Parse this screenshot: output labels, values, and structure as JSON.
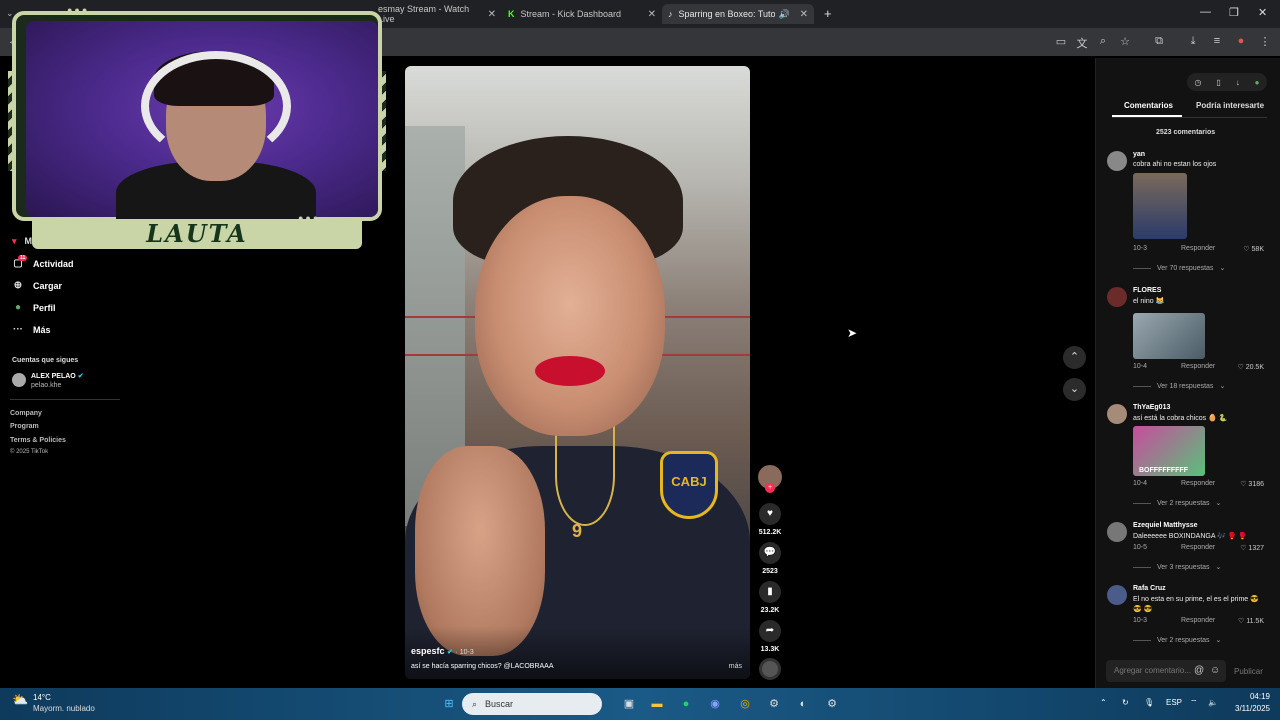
{
  "browser": {
    "tabs": [
      {
        "label": "esmay Stream - Watch Live",
        "active": false
      },
      {
        "label": "Stream - Kick Dashboard",
        "active": false
      },
      {
        "label": "Sparring en Boxeo: Tutorial",
        "active": true
      }
    ],
    "new_tab": "+"
  },
  "sidebar": {
    "items": [
      {
        "label": "Actividad",
        "icon": "activity-icon",
        "badge": "11"
      },
      {
        "label": "Cargar",
        "icon": "upload-icon"
      },
      {
        "label": "Perfil",
        "icon": "profile-icon"
      },
      {
        "label": "Más",
        "icon": "more-icon"
      }
    ],
    "partial_item": "M",
    "following_heading": "Cuentas que sigues",
    "following": [
      {
        "name": "ALEX PELAO",
        "handle": "pelao.khe"
      }
    ],
    "footer": [
      "Company",
      "Program",
      "Terms & Policies",
      "© 2025 TikTok"
    ]
  },
  "video": {
    "username": "espesfc",
    "date": "10-3",
    "caption": "así se hacía sparring chicos? @LACOBRAAA",
    "more": "más",
    "shirt_badge": "CABJ",
    "shirt_number": "9"
  },
  "actions": {
    "likes": "512.2K",
    "comments": "2523",
    "saves": "23.2K",
    "shares": "13.3K"
  },
  "comments_panel": {
    "tabs": [
      "Comentarios",
      "Podría interesarte"
    ],
    "count": "2523 comentarios",
    "reply_label": "Responder",
    "comments": [
      {
        "user": "yan",
        "text": "cobra ahi no estan los ojos",
        "date": "10-3",
        "likes": "58K",
        "replies": "Ver 70 respuestas"
      },
      {
        "user": "FLORES",
        "text": "el nino 😹",
        "date": "10-4",
        "likes": "20.5K",
        "replies": "Ver 18 respuestas"
      },
      {
        "user": "ThYaEg013",
        "text": "así está la cobra chicos 🥚 🐍",
        "date": "10-4",
        "likes": "3186",
        "replies": "Ver 2 respuestas",
        "image_text": "BOFFFFFFFFF"
      },
      {
        "user": "Ezequiel Matthysse",
        "text": "Daleeeeee BOXINDANGA 🎶 🥊 🥊",
        "date": "10-5",
        "likes": "1327",
        "replies": "Ver 3 respuestas"
      },
      {
        "user": "Rafa Cruz",
        "text": "El no esta en su prime, el es el prime 😎",
        "text2": "😎 😎",
        "date": "10-3",
        "likes": "11.5K",
        "replies": "Ver 2 respuestas"
      }
    ],
    "input_placeholder": "Agregar comentario...",
    "publish": "Publicar"
  },
  "overlay": {
    "streamer_name": "LAUTA"
  },
  "taskbar": {
    "weather_temp": "14°C",
    "weather_desc": "Mayorm. nublado",
    "search": "Buscar",
    "lang": "ESP",
    "time": "04:19",
    "date": "3/11/2025"
  },
  "colors": {
    "accent_green": "#c9d5a7",
    "like_red": "#fe2c55",
    "taskbar": "#1a5a86"
  }
}
